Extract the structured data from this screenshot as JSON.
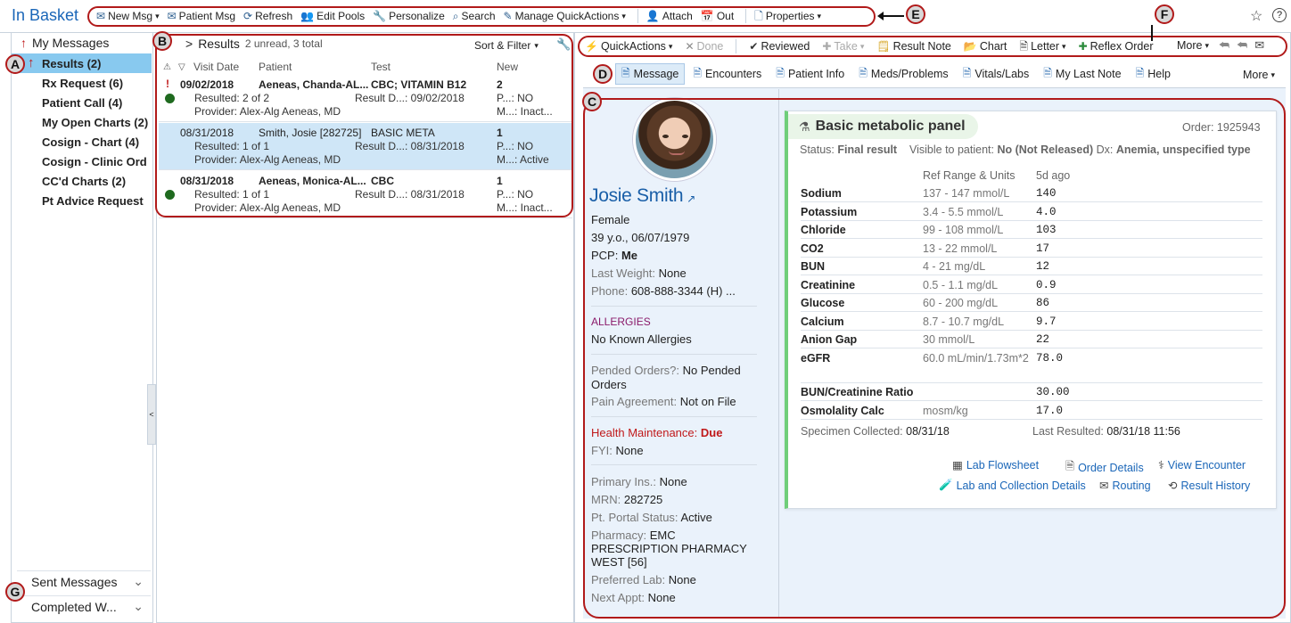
{
  "app": {
    "title": "In Basket"
  },
  "toolbar": {
    "items": [
      {
        "name": "new-msg",
        "label": "New Msg",
        "icon": "✉",
        "caret": true
      },
      {
        "name": "patient-msg",
        "label": "Patient Msg",
        "icon": "✉",
        "caret": false
      },
      {
        "name": "refresh",
        "label": "Refresh",
        "icon": "⟳",
        "caret": false
      },
      {
        "name": "edit-pools",
        "label": "Edit Pools",
        "icon": "👥",
        "caret": false
      },
      {
        "name": "personalize",
        "label": "Personalize",
        "icon": "🔧",
        "caret": false
      },
      {
        "name": "search",
        "label": "Search",
        "icon": "⌕",
        "caret": false
      },
      {
        "name": "manage-quickactions",
        "label": "Manage QuickActions",
        "icon": "✎",
        "caret": true
      },
      {
        "name": "attach",
        "label": "Attach",
        "icon": "👤",
        "caret": false
      },
      {
        "name": "out",
        "label": "Out",
        "icon": "📅",
        "caret": false
      },
      {
        "name": "properties",
        "label": "Properties",
        "icon": "🗋",
        "caret": true
      }
    ]
  },
  "sidebar": {
    "header": "My Messages",
    "items": [
      {
        "label": "Results (2)",
        "selected": true
      },
      {
        "label": "Rx Request (6)",
        "selected": false
      },
      {
        "label": "Patient Call (4)",
        "selected": false
      },
      {
        "label": "My Open Charts (2)",
        "selected": false
      },
      {
        "label": "Cosign - Chart (4)",
        "selected": false
      },
      {
        "label": "Cosign - Clinic Ord",
        "selected": false
      },
      {
        "label": "CC'd Charts (2)",
        "selected": false
      },
      {
        "label": "Pt Advice Request",
        "selected": false
      }
    ],
    "bottom": [
      {
        "label": "Sent Messages"
      },
      {
        "label": "Completed W..."
      }
    ]
  },
  "list": {
    "folder": "Results",
    "chevron": ">",
    "counts": "2 unread, 3 total",
    "sort_filter": "Sort & Filter",
    "columns": {
      "visit_date": "Visit Date",
      "patient": "Patient",
      "test": "Test",
      "new": "New"
    },
    "rows": [
      {
        "date": "09/02/2018",
        "patient": "Aeneas, Chanda-AL...",
        "test": "CBC; VITAMIN B12",
        "new": "2",
        "resulted": "Resulted: 2 of 2",
        "result_d": "Result D...: 09/02/2018",
        "p": "P...: NO",
        "provider": "Provider: Alex-Alg Aeneas, MD",
        "m": "M...: Inact...",
        "bold": true,
        "flag": "!",
        "dot": true,
        "selected": false
      },
      {
        "date": "08/31/2018",
        "patient": "Smith, Josie [282725]",
        "test": "BASIC META",
        "new": "1",
        "resulted": "Resulted: 1 of 1",
        "result_d": "Result D...: 08/31/2018",
        "p": "P...: NO",
        "provider": "Provider: Alex-Alg Aeneas, MD",
        "m": "M...: Active",
        "bold": false,
        "flag": "",
        "dot": false,
        "selected": true
      },
      {
        "date": "08/31/2018",
        "patient": "Aeneas, Monica-AL...",
        "test": "CBC",
        "new": "1",
        "resulted": "Resulted: 1 of 1",
        "result_d": "Result D...: 08/31/2018",
        "p": "P...: NO",
        "provider": "Provider: Alex-Alg Aeneas, MD",
        "m": "M...: Inact...",
        "bold": true,
        "flag": "",
        "dot": true,
        "selected": false
      }
    ]
  },
  "actions": {
    "items": [
      {
        "name": "quickactions",
        "label": "QuickActions",
        "icon": "⚡",
        "caret": true,
        "disabled": false
      },
      {
        "name": "done",
        "label": "Done",
        "icon": "✕",
        "caret": false,
        "disabled": true
      },
      {
        "name": "reviewed",
        "label": "Reviewed",
        "icon": "✔",
        "caret": false,
        "disabled": false
      },
      {
        "name": "take",
        "label": "Take",
        "icon": "✚",
        "caret": true,
        "disabled": true
      },
      {
        "name": "result-note",
        "label": "Result Note",
        "icon": "🗒",
        "caret": false,
        "disabled": false
      },
      {
        "name": "chart",
        "label": "Chart",
        "icon": "📂",
        "caret": false,
        "disabled": false
      },
      {
        "name": "letter",
        "label": "Letter",
        "icon": "🗎",
        "caret": true,
        "disabled": false
      },
      {
        "name": "reflex-order",
        "label": "Reflex Order",
        "icon": "✚",
        "caret": false,
        "disabled": false
      }
    ],
    "more": "More"
  },
  "tabs": {
    "items": [
      {
        "label": "Message",
        "active": true
      },
      {
        "label": "Encounters",
        "active": false
      },
      {
        "label": "Patient Info",
        "active": false
      },
      {
        "label": "Meds/Problems",
        "active": false
      },
      {
        "label": "Vitals/Labs",
        "active": false
      },
      {
        "label": "My Last Note",
        "active": false
      },
      {
        "label": "Help",
        "active": false
      }
    ],
    "more": "More"
  },
  "patient": {
    "name": "Josie Smith",
    "sex": "Female",
    "age_dob": "39 y.o., 06/07/1979",
    "pcp_label": "PCP:",
    "pcp": "Me",
    "weight_label": "Last Weight:",
    "weight": "None",
    "phone_label": "Phone:",
    "phone": "608-888-3344 (H) ...",
    "allergies_header": "ALLERGIES",
    "allergies": "No Known Allergies",
    "pended_label": "Pended Orders?:",
    "pended": "No Pended Orders",
    "pain_label": "Pain Agreement:",
    "pain": "Not on File",
    "hm_label": "Health Maintenance:",
    "hm": "Due",
    "fyi_label": "FYI:",
    "fyi": "None",
    "ins_label": "Primary Ins.:",
    "ins": "None",
    "mrn_label": "MRN:",
    "mrn": "282725",
    "portal_label": "Pt. Portal Status:",
    "portal": "Active",
    "pharmacy_label": "Pharmacy:",
    "pharmacy": "EMC PRESCRIPTION PHARMACY WEST [56]",
    "preflab_label": "Preferred Lab:",
    "preflab": "None",
    "appt_label": "Next Appt:",
    "appt": "None"
  },
  "result": {
    "title": "Basic metabolic panel",
    "order": "Order: 1925943",
    "status_label": "Status:",
    "status": "Final result",
    "visible_label": "Visible to patient:",
    "visible": "No (Not Released)",
    "dx_label": "Dx:",
    "dx": "Anemia, unspecified type",
    "col_ref": "Ref Range & Units",
    "col_date": "5d ago",
    "rows": [
      {
        "name": "Sodium",
        "ref": "137 - 147 mmol/L",
        "value": "140"
      },
      {
        "name": "Potassium",
        "ref": "3.4 - 5.5 mmol/L",
        "value": "4.0"
      },
      {
        "name": "Chloride",
        "ref": "99 - 108 mmol/L",
        "value": "103"
      },
      {
        "name": "CO2",
        "ref": "13 - 22 mmol/L",
        "value": "17"
      },
      {
        "name": "BUN",
        "ref": "4 - 21 mg/dL",
        "value": "12"
      },
      {
        "name": "Creatinine",
        "ref": "0.5 - 1.1 mg/dL",
        "value": "0.9"
      },
      {
        "name": "Glucose",
        "ref": "60 - 200 mg/dL",
        "value": "86"
      },
      {
        "name": "Calcium",
        "ref": "8.7 - 10.7 mg/dL",
        "value": "9.7"
      },
      {
        "name": "Anion Gap",
        "ref": "30 mmol/L",
        "value": "22"
      },
      {
        "name": "eGFR",
        "ref": "60.0 mL/min/1.73m*2",
        "value": "78.0"
      },
      {
        "name": "BUN/Creatinine Ratio",
        "ref": "",
        "value": "30.00"
      },
      {
        "name": "Osmolality Calc",
        "ref": "mosm/kg",
        "value": "17.0"
      }
    ],
    "collected_label": "Specimen Collected:",
    "collected": "08/31/18",
    "last_label": "Last Resulted:",
    "last": "08/31/18 11:56",
    "links": [
      "Lab Flowsheet",
      "Order Details",
      "View Encounter",
      "Lab and Collection Details",
      "Routing",
      "Result History"
    ]
  },
  "callouts": [
    "A",
    "B",
    "C",
    "D",
    "E",
    "F",
    "G"
  ],
  "colors": {
    "brand": "#1a66b8",
    "callout": "#b11a1a",
    "selected": "#cfe6f7",
    "nav_selected": "#88c9ef"
  }
}
